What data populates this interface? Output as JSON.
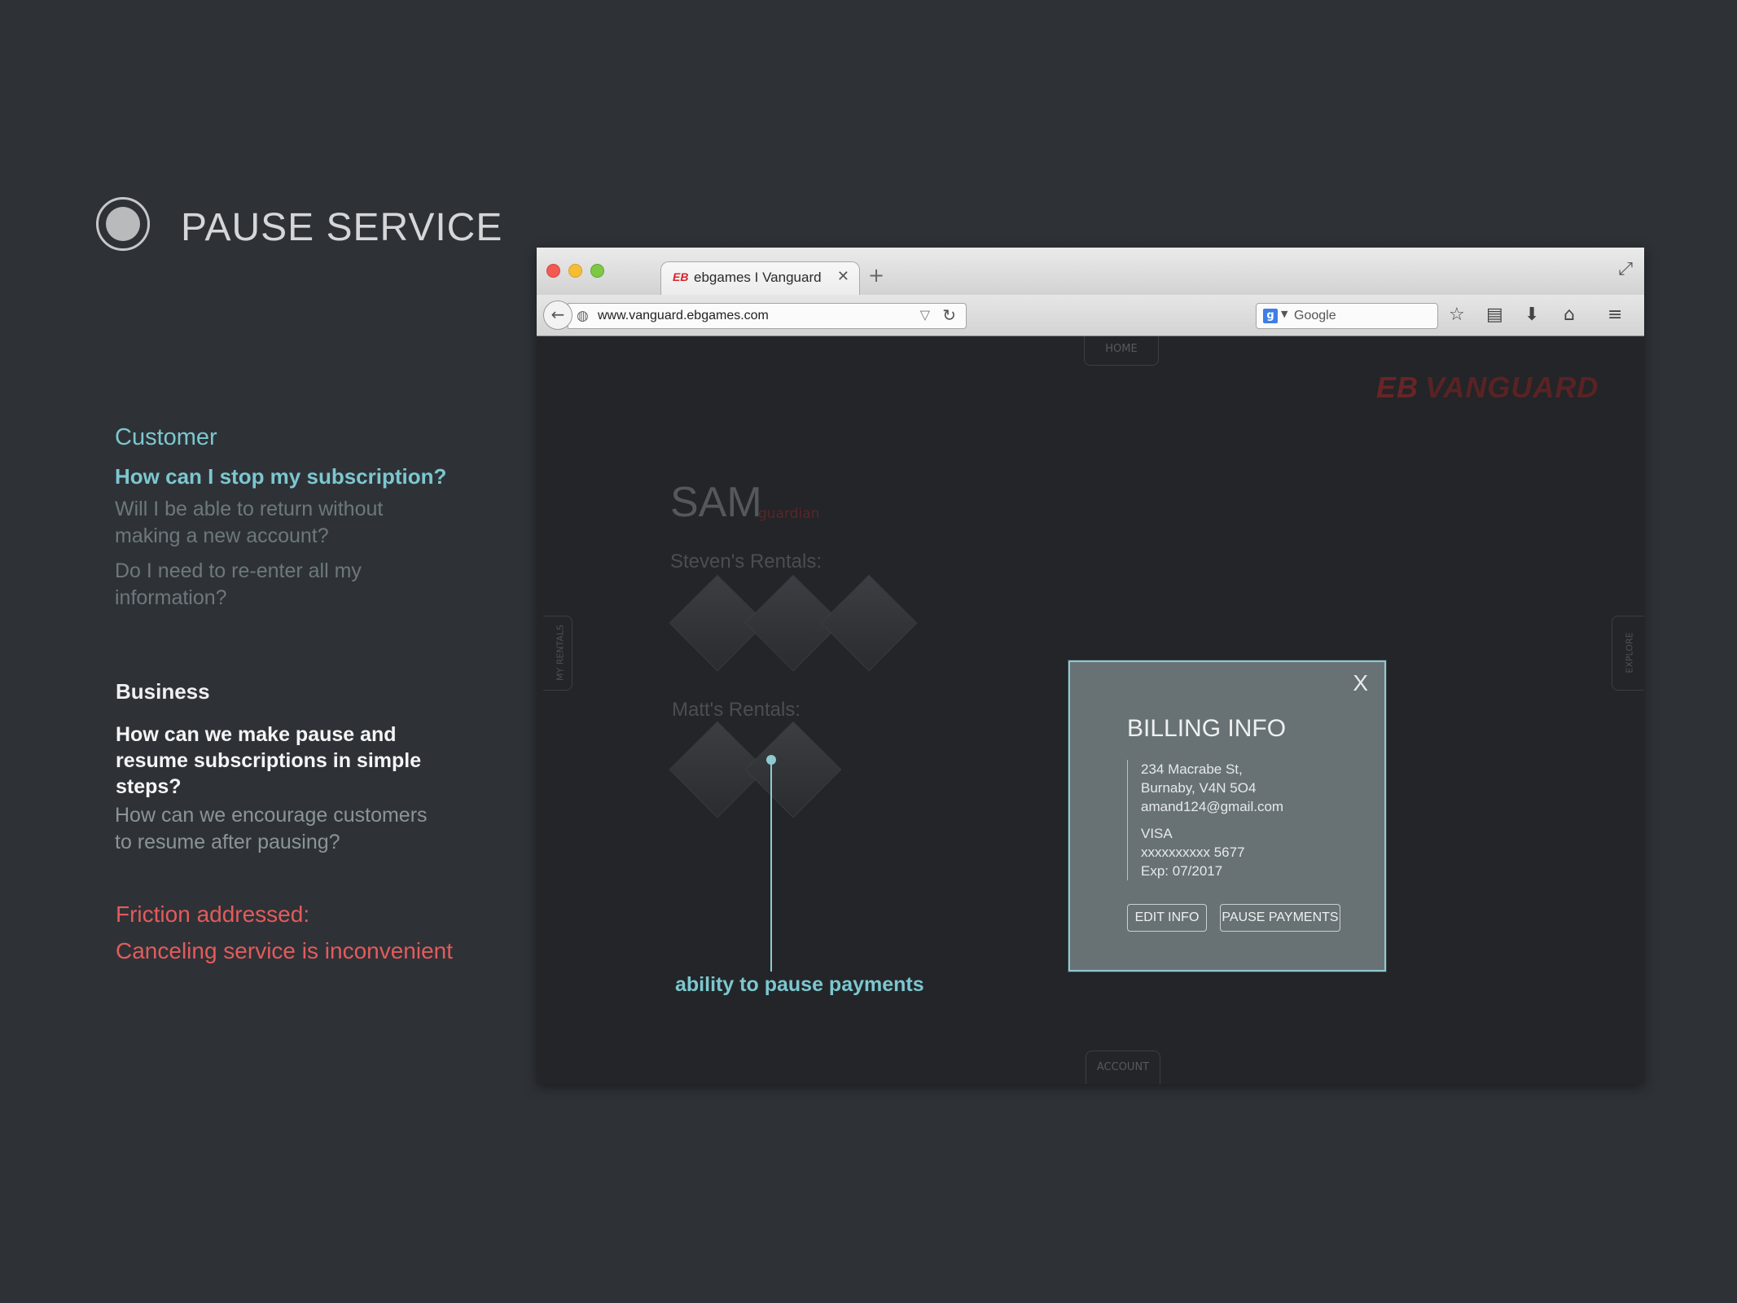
{
  "slide": {
    "title": "PAUSE SERVICE",
    "customer": {
      "heading": "Customer",
      "primary_question": "How can I stop my subscription?",
      "questions": [
        "Will I be able to return without making a new account?",
        "Do I need to re-enter all my information?"
      ]
    },
    "business": {
      "heading": "Business",
      "primary_question": "How can we make pause and resume subscriptions in simple steps?",
      "question": "How can we encourage customers to resume after pausing?"
    },
    "friction": {
      "label": "Friction addressed:",
      "text": "Canceling service is inconvenient"
    },
    "callout": "ability to pause payments"
  },
  "browser": {
    "tab_title": "ebgames I Vanguard",
    "tab_logo": "EB",
    "url": "www.vanguard.ebgames.com",
    "search_placeholder": "Google"
  },
  "page": {
    "home_tab": "HOME",
    "account_tab": "ACCOUNT",
    "left_side_tab": "MY RENTALS",
    "right_side_tab": "EXPLORE",
    "brand_prefix": "EB",
    "brand": "VANGUARD",
    "user_name": "SAM",
    "user_role": "guardian",
    "rentals": [
      "Steven's Rentals:",
      "Matt's Rentals:"
    ]
  },
  "modal": {
    "close": "X",
    "title": "BILLING INFO",
    "address_lines": [
      "234 Macrabe St,",
      "Burnaby, V4N 5O4",
      "amand124@gmail.com"
    ],
    "card_lines": [
      "VISA",
      "xxxxxxxxxx 5677",
      "Exp: 07/2017"
    ],
    "edit_button": "EDIT INFO",
    "pause_button": "PAUSE PAYMENTS"
  },
  "colors": {
    "background": "#2e3237",
    "accent": "#7cc7cf",
    "friction": "#e45b5b",
    "modal_bg": "#687275"
  }
}
